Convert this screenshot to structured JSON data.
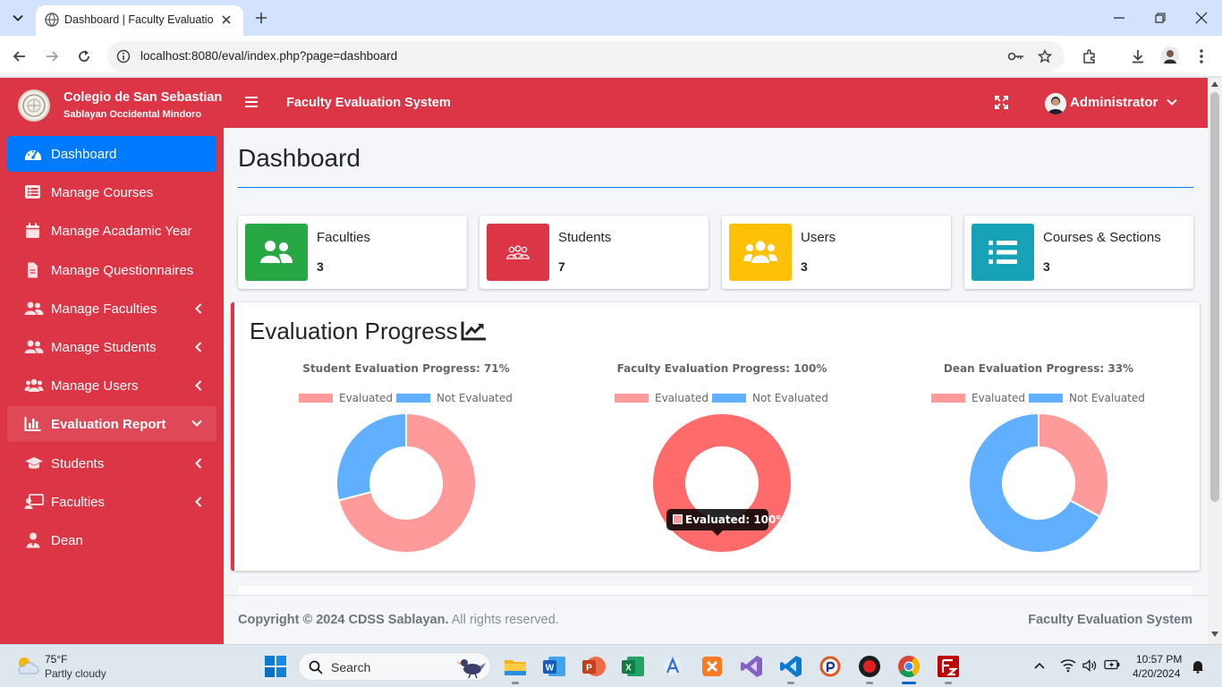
{
  "browser": {
    "tab_title": "Dashboard | Faculty Evaluation System",
    "url": "localhost:8080/eval/index.php?page=dashboard"
  },
  "sidebar": {
    "brand_name": "Colegio de San Sebastian",
    "brand_sub": "Sablayan Occidental Mindoro",
    "items": [
      {
        "label": "Dashboard",
        "icon": "tachometer-icon"
      },
      {
        "label": "Manage Courses",
        "icon": "list-icon"
      },
      {
        "label": "Manage Acadamic Year",
        "icon": "calendar-icon"
      },
      {
        "label": "Manage Questionnaires",
        "icon": "file-icon"
      },
      {
        "label": "Manage Faculties",
        "icon": "user-friends-icon"
      },
      {
        "label": "Manage Students",
        "icon": "user-friends-icon"
      },
      {
        "label": "Manage Users",
        "icon": "users-icon"
      },
      {
        "label": "Evaluation Report",
        "icon": "bar-chart-icon"
      },
      {
        "label": "Students",
        "icon": "graduation-cap-icon"
      },
      {
        "label": "Faculties",
        "icon": "chalkboard-teacher-icon"
      },
      {
        "label": "Dean",
        "icon": "user-tie-icon"
      }
    ]
  },
  "navbar": {
    "system_name": "Faculty Evaluation System",
    "user_name": "Administrator"
  },
  "page": {
    "title": "Dashboard"
  },
  "stats": [
    {
      "label": "Faculties",
      "value": "3",
      "color": "#28a745",
      "icon": "users-icon"
    },
    {
      "label": "Students",
      "value": "7",
      "color": "#dc3545",
      "icon": "people-group-icon"
    },
    {
      "label": "Users",
      "value": "3",
      "color": "#ffc107",
      "icon": "users-icon"
    },
    {
      "label": "Courses & Sections",
      "value": "3",
      "color": "#17a2b8",
      "icon": "list-icon"
    }
  ],
  "progress": {
    "title": "Evaluation Progress",
    "icon": "chart-line-icon"
  },
  "chart_data": [
    {
      "type": "pie",
      "title": "Student Evaluation Progress: 71%",
      "categories": [
        "Evaluated",
        "Not Evaluated"
      ],
      "values": [
        71,
        29
      ],
      "colors": [
        "#ff9a9a",
        "#60b0ff"
      ],
      "legend": "top"
    },
    {
      "type": "pie",
      "title": "Faculty Evaluation Progress: 100%",
      "categories": [
        "Evaluated",
        "Not Evaluated"
      ],
      "values": [
        100,
        0
      ],
      "colors": [
        "#ff9a9a",
        "#60b0ff"
      ],
      "legend": "top",
      "tooltip": "Evaluated: 100%"
    },
    {
      "type": "pie",
      "title": "Dean Evaluation Progress: 33%",
      "categories": [
        "Evaluated",
        "Not Evaluated"
      ],
      "values": [
        33,
        67
      ],
      "colors": [
        "#ff9a9a",
        "#60b0ff"
      ],
      "legend": "top"
    }
  ],
  "footer": {
    "copyright_bold": "Copyright © 2024 CDSS Sablayan.",
    "rights": " All rights reserved.",
    "right": "Faculty Evaluation System"
  },
  "taskbar": {
    "temp": "75°F",
    "weather": "Partly cloudy",
    "search": "Search",
    "time": "10:57 PM",
    "date": "4/20/2024"
  }
}
